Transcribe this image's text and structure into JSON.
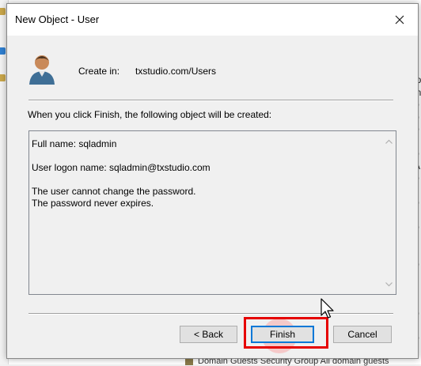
{
  "dialog": {
    "title": "New Object - User",
    "create_in_label": "Create in:",
    "create_in_path": "txstudio.com/Users",
    "message": "When you click Finish, the following object will be created:",
    "summary_lines": [
      "Full name: sqladmin",
      "",
      "User logon name: sqladmin@txstudio.com",
      "",
      "The user cannot change the password.",
      "The password never expires."
    ],
    "buttons": {
      "back": "< Back",
      "finish": "Finish",
      "cancel": "Cancel"
    }
  },
  "background": {
    "right_fragments": [
      "ip",
      "in",
      "b",
      "b",
      "b",
      "r",
      "b",
      "A",
      "b",
      "r",
      "b",
      "n",
      "b",
      "r",
      "n",
      "b",
      "n",
      "r",
      "n",
      "b",
      "r",
      "b",
      "n",
      "r"
    ],
    "bottom_text": "Domain Guests  Security Group  All domain guests"
  },
  "colors": {
    "highlight": "#e60000",
    "focus_border": "#0078d7"
  }
}
